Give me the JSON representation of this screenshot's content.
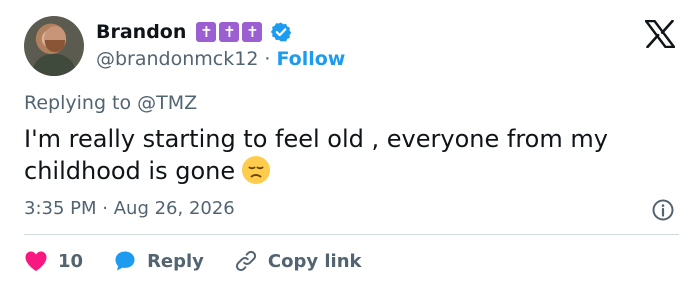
{
  "user": {
    "display_name": "Brandon",
    "badges": [
      "✝",
      "✝",
      "✝"
    ],
    "handle": "@brandonmck12",
    "separator": "·",
    "follow_label": "Follow"
  },
  "reply_context": {
    "prefix": "Replying to",
    "mention": "@TMZ"
  },
  "tweet": {
    "text": "I'm really starting to feel old , everyone from my childhood is gone",
    "emoji": "disappointed-face-emoji",
    "time": "3:35 PM",
    "separator": "·",
    "date": "Aug 26, 2026"
  },
  "actions": {
    "like_count": "10",
    "reply_label": "Reply",
    "copy_label": "Copy link"
  },
  "colors": {
    "accent": "#1d9bf0",
    "like": "#f91880",
    "badge": "#9b5fd1",
    "secondary_text": "#536471"
  },
  "icons": [
    "x-logo-icon",
    "verified-badge-icon",
    "info-icon",
    "heart-icon",
    "reply-bubble-icon",
    "link-icon"
  ]
}
